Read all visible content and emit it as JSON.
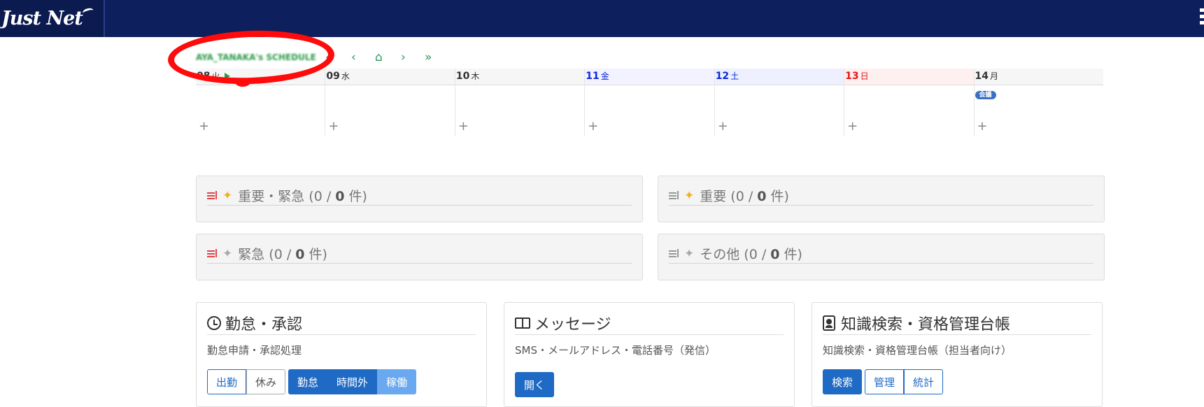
{
  "header": {
    "logo_text": "Just Net"
  },
  "schedule": {
    "title": "AYA_TANAKA's SCHEDULE",
    "nav": [
      "«",
      "‹",
      "⌂",
      "›",
      "»"
    ],
    "days": [
      {
        "num": "08",
        "wd": "火",
        "color": "#000000"
      },
      {
        "num": "09",
        "wd": "水",
        "color": "#000000"
      },
      {
        "num": "10",
        "wd": "木",
        "color": "#000000"
      },
      {
        "num": "11",
        "wd": "金",
        "color": "#0a28d8"
      },
      {
        "num": "12",
        "wd": "土",
        "color": "#0a28d8"
      },
      {
        "num": "13",
        "wd": "日",
        "color": "#e21818"
      },
      {
        "num": "14",
        "wd": "月",
        "color": "#000000"
      }
    ],
    "event_badge": "会議",
    "add_label": "+"
  },
  "tasks": [
    {
      "label": "重要・緊急 (0 / ",
      "count": "0",
      "suffix": " 件)",
      "icon_color": "#e0454a",
      "spark_color": "#f0b020"
    },
    {
      "label": "重要 (0 / ",
      "count": "0",
      "suffix": " 件)",
      "icon_color": "#999999",
      "spark_color": "#f0b020"
    },
    {
      "label": "緊急 (0 / ",
      "count": "0",
      "suffix": " 件)",
      "icon_color": "#e0454a",
      "spark_color": "#aaaaaa"
    },
    {
      "label": "その他 (0 / ",
      "count": "0",
      "suffix": " 件)",
      "icon_color": "#999999",
      "spark_color": "#aaaaaa"
    }
  ],
  "widgets": {
    "attendance": {
      "title": "勤怠・承認",
      "desc": "勤怠申請・承認処理",
      "buttons": [
        "出勤",
        "休み",
        "勤怠",
        "時間外",
        "稼働"
      ]
    },
    "message": {
      "title": "メッセージ",
      "desc": "SMS・メールアドレス・電話番号（発信）",
      "buttons": [
        "開く"
      ]
    },
    "knowledge": {
      "title": "知識検索・資格管理台帳",
      "desc": "知識検索・資格管理台帳（担当者向け）",
      "buttons": [
        "検索",
        "管理",
        "統計"
      ]
    }
  }
}
